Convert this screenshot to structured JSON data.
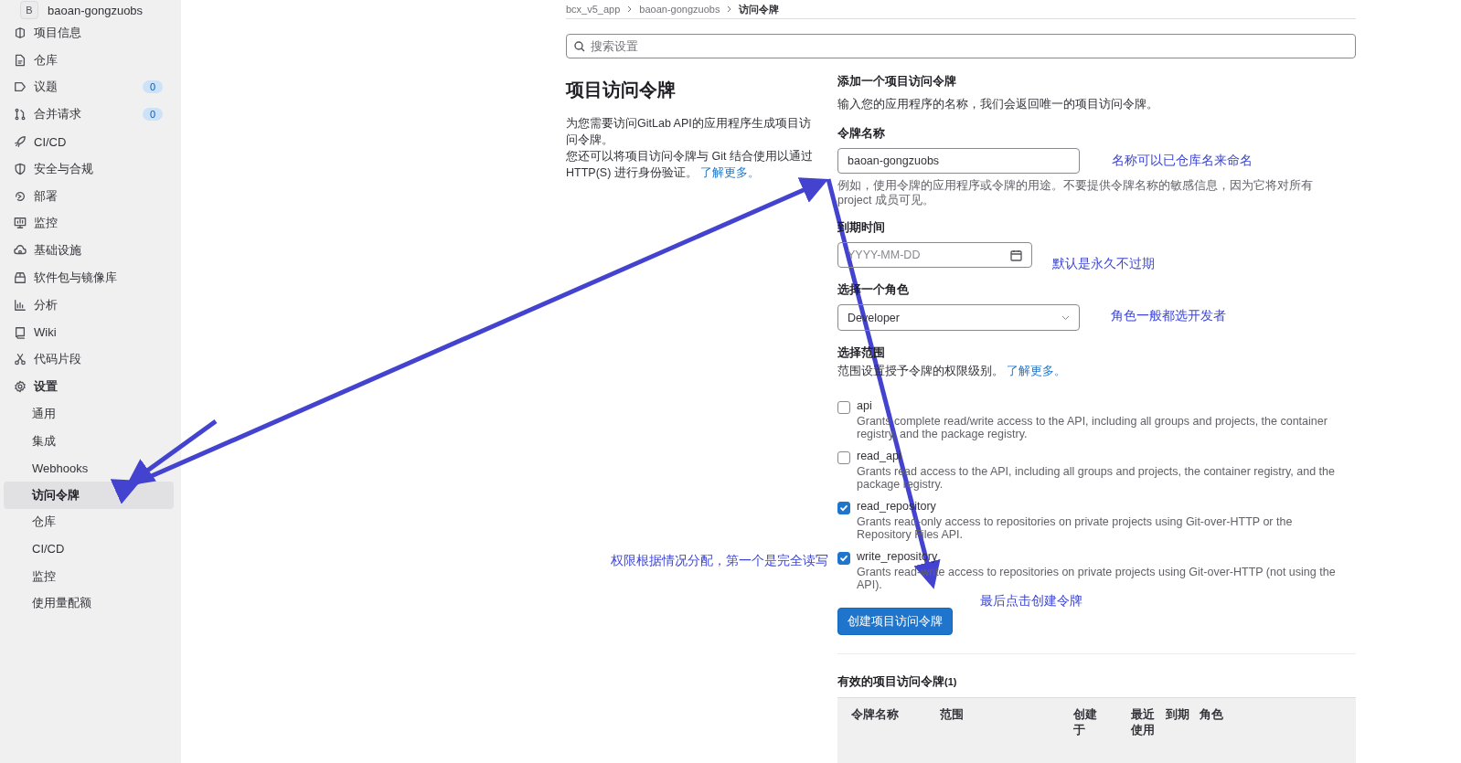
{
  "sidebar": {
    "project": {
      "avatar": "B",
      "name": "baoan-gongzuobs"
    },
    "items": [
      {
        "label": "项目信息",
        "expanded": false
      },
      {
        "label": "仓库",
        "expanded": false
      },
      {
        "label": "议题",
        "count": "0",
        "expanded": false
      },
      {
        "label": "合并请求",
        "count": "0",
        "expanded": false
      },
      {
        "label": "CI/CD",
        "expanded": false
      },
      {
        "label": "安全与合规",
        "expanded": false
      },
      {
        "label": "部署",
        "expanded": false
      },
      {
        "label": "监控",
        "expanded": false
      },
      {
        "label": "基础设施",
        "expanded": false
      },
      {
        "label": "软件包与镜像库",
        "expanded": false
      },
      {
        "label": "分析",
        "expanded": false
      },
      {
        "label": "Wiki",
        "expanded": false
      },
      {
        "label": "代码片段",
        "expanded": false
      },
      {
        "label": "设置",
        "expanded": true,
        "children": [
          {
            "label": "通用",
            "selected": false
          },
          {
            "label": "集成",
            "selected": false
          },
          {
            "label": "Webhooks",
            "selected": false
          },
          {
            "label": "访问令牌",
            "selected": true
          },
          {
            "label": "仓库",
            "selected": false
          },
          {
            "label": "CI/CD",
            "selected": false
          },
          {
            "label": "监控",
            "selected": false
          },
          {
            "label": "使用量配额",
            "selected": false
          }
        ]
      }
    ]
  },
  "breadcrumb": [
    "bcx_v5_app",
    "baoan-gongzuobs",
    "访问令牌"
  ],
  "search": {
    "placeholder": "搜索设置"
  },
  "intro": {
    "title": "项目访问令牌",
    "text": "为您需要访问GitLab API的应用程序生成项目访问令牌。",
    "text_2": "您还可以将项目访问令牌与 Git 结合使用以通过 HTTP(S) 进行身份验证。",
    "link": "了解更多。"
  },
  "form": {
    "title": "添加一个项目访问令牌",
    "subtitle": "输入您的应用程序的名称，我们会返回唯一的项目访问令牌。",
    "name": {
      "label": "令牌名称",
      "value": "baoan-gongzuobs",
      "help": "例如，使用令牌的应用程序或令牌的用途。不要提供令牌名称的敏感信息，因为它将对所有 project 成员可见。"
    },
    "expiry": {
      "label": "到期时间",
      "placeholder": "YYYY-MM-DD"
    },
    "role": {
      "label": "选择一个角色",
      "value": "Developer"
    },
    "scopes": {
      "label": "选择范围",
      "help": "范围设置授予令牌的权限级别。",
      "link": "了解更多。",
      "items": [
        {
          "name": "api",
          "description": "Grants complete read/write access to the API, including all groups and projects, the container registry, and the package registry.",
          "checked": false
        },
        {
          "name": "read_api",
          "description": "Grants read access to the API, including all groups and projects, the container registry, and the package registry.",
          "checked": false
        },
        {
          "name": "read_repository",
          "description": "Grants read-only access to repositories on private projects using Git-over-HTTP or the Repository Files API.",
          "checked": true
        },
        {
          "name": "write_repository",
          "description": "Grants read-write access to repositories on private projects using Git-over-HTTP (not using the API).",
          "checked": true
        }
      ]
    },
    "submit": "创建项目访问令牌"
  },
  "active_tokens": {
    "title": "有效的项目访问令牌",
    "count": "(1)",
    "columns": [
      "令牌名称",
      "范围",
      "创建于",
      "最近使用",
      "到期",
      "角色"
    ]
  },
  "annotations": [
    "名称可以已仓库名来命名",
    "默认是永久不过期",
    "角色一般都选开发者",
    "权限根据情况分配，第一个是完全读写",
    "最后点击创建令牌"
  ]
}
